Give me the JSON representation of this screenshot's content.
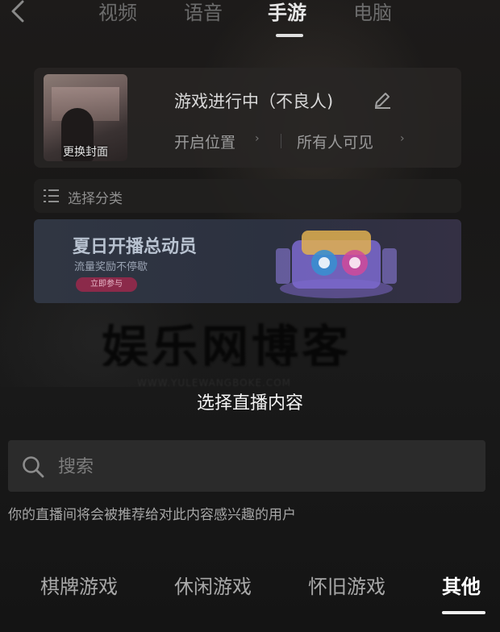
{
  "top_tabs": [
    {
      "label": "视频"
    },
    {
      "label": "语音"
    },
    {
      "label": "手游"
    },
    {
      "label": "电脑"
    }
  ],
  "active_top_tab": "手游",
  "stream": {
    "cover_label": "更换封面",
    "title": "游戏进行中（不良人)",
    "location_label": "开启位置",
    "visibility_label": "所有人可见"
  },
  "category": {
    "label": "选择分类"
  },
  "banner": {
    "title": "夏日开播总动员",
    "subtitle": "流量奖励不停歇",
    "button_label": "立即参与"
  },
  "sheet": {
    "title": "选择直播内容",
    "search_placeholder": "搜索",
    "hint": "你的直播间将会被推荐给对此内容感兴趣的用户",
    "tabs": [
      {
        "label": "棋牌游戏"
      },
      {
        "label": "休闲游戏"
      },
      {
        "label": "怀旧游戏"
      },
      {
        "label": "其他"
      }
    ],
    "active_tab": "其他"
  }
}
